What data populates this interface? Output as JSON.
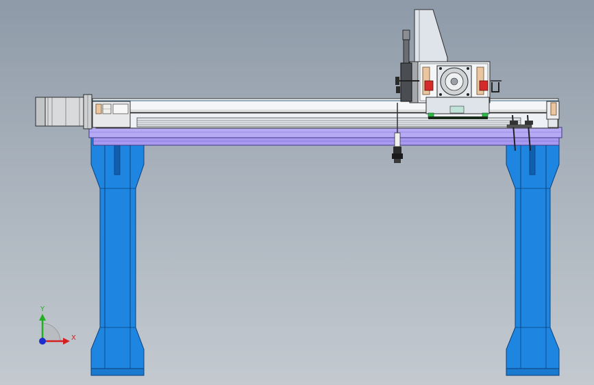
{
  "viewport": {
    "background_top": "#8e9aa8",
    "background_bottom": "#c3c9cf"
  },
  "colors": {
    "frame_blue": "#1e86e0",
    "frame_blue_dark": "#1060b0",
    "beam_lavender": "#a99af0",
    "rail_white": "#f4f6f8",
    "motor_gray": "#d8dadc",
    "carriage_gray": "#dfe3ea",
    "accent_red": "#d42a2a",
    "accent_green": "#2fb84a",
    "accent_tan": "#e9c6a0"
  },
  "triad": {
    "x_label": "X",
    "y_label": "Y",
    "x_color": "#d42020",
    "y_color": "#20b020",
    "z_color": "#1c2ed0"
  },
  "icons": {
    "triad": "coordinate-triad-icon"
  }
}
